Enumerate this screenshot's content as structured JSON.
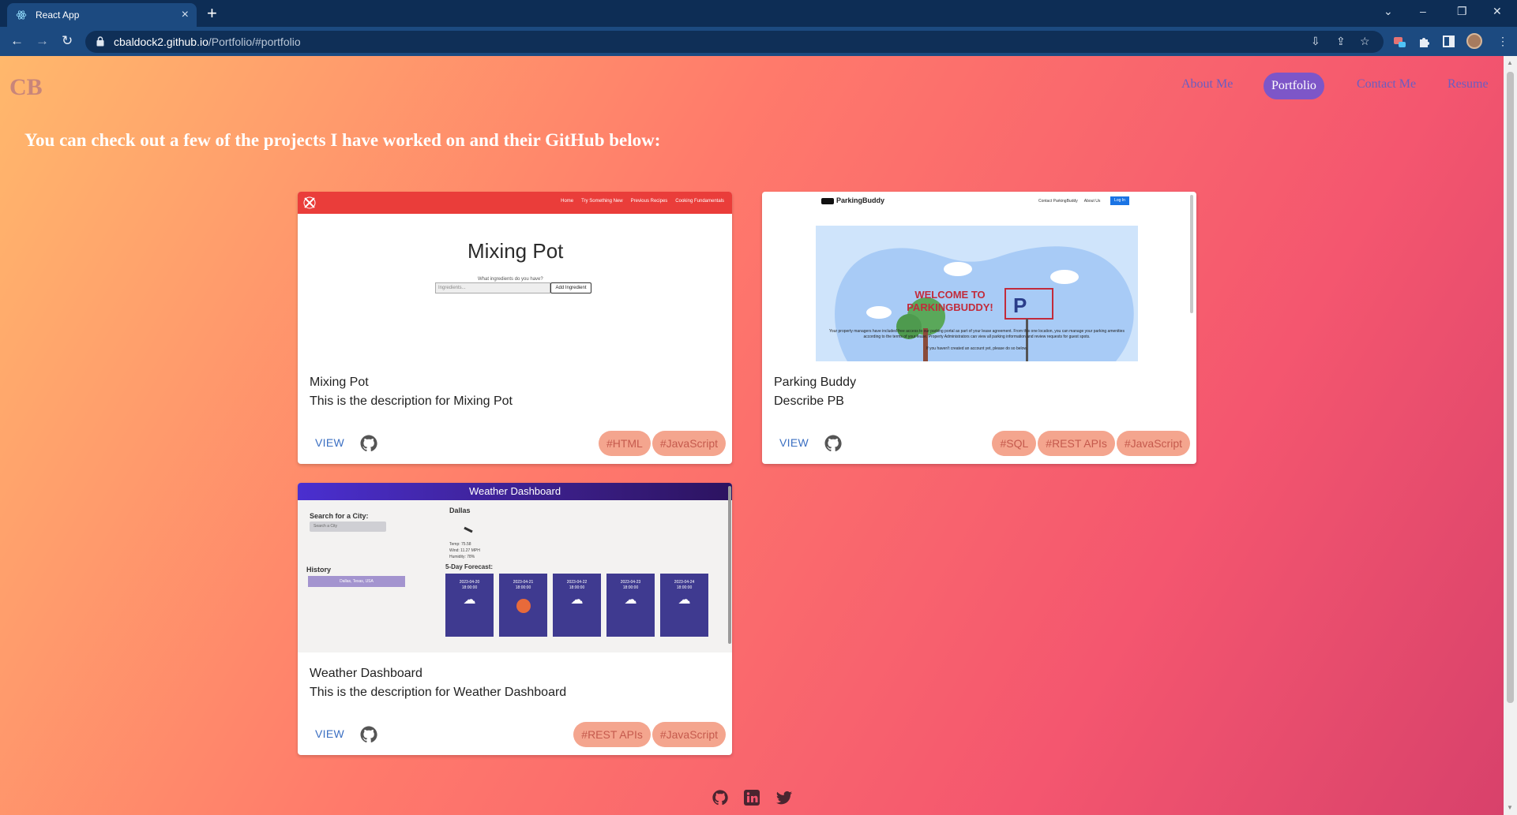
{
  "browser": {
    "tab_title": "React App",
    "url_host": "cbaldock2.github.io",
    "url_path": "/Portfolio/#portfolio"
  },
  "site": {
    "logo": "CB",
    "nav": {
      "about": "About Me",
      "portfolio": "Portfolio",
      "contact": "Contact Me",
      "resume": "Resume"
    },
    "intro": "You can check out a few of the projects I have worked on and their GitHub below:"
  },
  "projects": [
    {
      "title": "Mixing Pot",
      "description": "This is the description for Mixing Pot",
      "view_label": "VIEW",
      "tags": [
        "#HTML",
        "#JavaScript"
      ],
      "preview": {
        "nav_links": [
          "Home",
          "Try Something New",
          "Previous Recipes",
          "Cooking Fundamentals"
        ],
        "brand": "Mixing Pot",
        "prompt": "What ingredients do you have?",
        "input_placeholder": "Ingredients...",
        "button": "Add Ingredient"
      }
    },
    {
      "title": "Parking Buddy",
      "description": "Describe PB",
      "view_label": "VIEW",
      "tags": [
        "#SQL",
        "#REST APIs",
        "#JavaScript"
      ],
      "preview": {
        "brand": "ParkingBuddy",
        "nav_links": [
          "Contact ParkingBuddy",
          "About Us"
        ],
        "login": "Log In",
        "welcome": "WELCOME TO PARKINGBUDDY!",
        "body": "Your property managers have included free access to our parking portal as part of your lease agreement. From this one location, you can manage your parking amenities according to the terms of your lease. Property Administrators can view all parking information and review requests for guest spots.",
        "footer": "If you haven't created an account yet, please do so below."
      }
    },
    {
      "title": "Weather Dashboard",
      "description": "This is the description for Weather Dashboard",
      "view_label": "VIEW",
      "tags": [
        "#REST APIs",
        "#JavaScript"
      ],
      "preview": {
        "header": "Weather Dashboard",
        "search_label": "Search for a City:",
        "search_placeholder": "Search a City",
        "history_label": "History",
        "history_item": "Dallas, Texas, USA",
        "city": "Dallas",
        "forecast_label": "5-Day Forecast:",
        "info": [
          "Temp: 75.58",
          "Wind: 11.27 MPH",
          "Humidity: 78%"
        ],
        "forecast": [
          {
            "date": "2023-04-20",
            "time": "18:00:00"
          },
          {
            "date": "2023-04-21",
            "time": "18:00:00"
          },
          {
            "date": "2023-04-22",
            "time": "18:00:00"
          },
          {
            "date": "2023-04-23",
            "time": "18:00:00"
          },
          {
            "date": "2023-04-24",
            "time": "18:00:00"
          }
        ]
      }
    }
  ],
  "colors": {
    "accent": "#7d56c8",
    "tag_bg": "#f4a58e",
    "tag_text": "#c55a4d"
  },
  "icons": [
    "github-icon",
    "linkedin-icon",
    "twitter-icon"
  ]
}
